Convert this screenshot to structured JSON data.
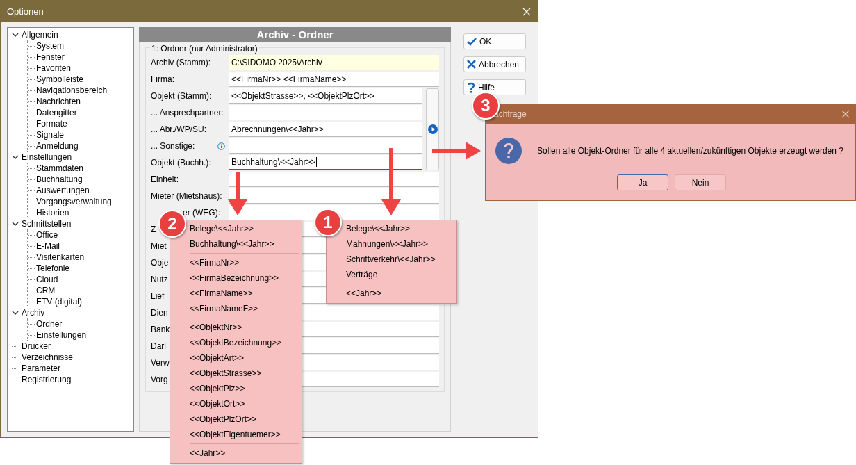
{
  "window": {
    "title": "Optionen"
  },
  "tree": [
    {
      "label": "Allgemein",
      "expanded": true,
      "children": [
        {
          "label": "System"
        },
        {
          "label": "Fenster"
        },
        {
          "label": "Favoriten"
        },
        {
          "label": "Symbolleiste"
        },
        {
          "label": "Navigationsbereich"
        },
        {
          "label": "Nachrichten"
        },
        {
          "label": "Datengitter"
        },
        {
          "label": "Formate"
        },
        {
          "label": "Signale"
        },
        {
          "label": "Anmeldung"
        }
      ]
    },
    {
      "label": "Einstellungen",
      "expanded": true,
      "children": [
        {
          "label": "Stammdaten"
        },
        {
          "label": "Buchhaltung"
        },
        {
          "label": "Auswertungen"
        },
        {
          "label": "Vorgangsverwaltung"
        },
        {
          "label": "Historien"
        }
      ]
    },
    {
      "label": "Schnittstellen",
      "expanded": true,
      "children": [
        {
          "label": "Office"
        },
        {
          "label": "E-Mail"
        },
        {
          "label": "Visitenkarten"
        },
        {
          "label": "Telefonie"
        },
        {
          "label": "Cloud"
        },
        {
          "label": "CRM"
        },
        {
          "label": "ETV (digital)"
        }
      ]
    },
    {
      "label": "Archiv",
      "expanded": true,
      "children": [
        {
          "label": "Ordner"
        },
        {
          "label": "Einstellungen"
        }
      ]
    },
    {
      "label": "Drucker",
      "expanded": false
    },
    {
      "label": "Verzeichnisse",
      "expanded": false
    },
    {
      "label": "Parameter",
      "expanded": false
    },
    {
      "label": "Registrierung",
      "expanded": false
    }
  ],
  "panel": {
    "title": "Archiv - Ordner",
    "group": "1: Ordner  (nur Administrator)",
    "rows": [
      {
        "label": "Archiv (Stamm):",
        "value": "C:\\SIDOMO 2025\\Archiv",
        "kind": "full",
        "highlighted": true,
        "focused": false,
        "info": false
      },
      {
        "label": "Firma:",
        "value": "<<FirmaNr>> <<FirmaName>>",
        "kind": "full",
        "highlighted": false,
        "focused": false,
        "info": false
      },
      {
        "label": "Objekt (Stamm):",
        "value": "<<ObjektStrasse>>, <<ObjektPlzOrt>>",
        "kind": "short",
        "highlighted": false,
        "focused": false,
        "info": false
      },
      {
        "label": "... Ansprechpartner:",
        "kind": "short",
        "highlighted": false,
        "focused": false,
        "info": false
      },
      {
        "label": "... Abr./WP/SU:",
        "value": "Abrechnungen\\<<Jahr>>",
        "kind": "short",
        "highlighted": false,
        "focused": false,
        "info": false
      },
      {
        "label": "... Sonstige:",
        "kind": "short",
        "highlighted": false,
        "focused": false,
        "info": true
      },
      {
        "label": "Objekt (Buchh.):",
        "value": "Buchhaltung\\<<Jahr>>",
        "kind": "short",
        "highlighted": false,
        "focused": true,
        "info": false
      },
      {
        "label": "Einheit:",
        "kind": "full",
        "highlighted": false,
        "focused": false,
        "info": false
      },
      {
        "label": "Mieter (Mietshaus):",
        "kind": "full",
        "highlighted": false,
        "focused": false,
        "info": false
      },
      {
        "label": "er (WEG):",
        "kind": "full",
        "highlighted": false,
        "focused": false,
        "info": false
      },
      {
        "label": "Z",
        "kind": "full",
        "highlighted": false,
        "focused": false,
        "info": false
      },
      {
        "label": "Miet",
        "kind": "full",
        "highlighted": false,
        "focused": false,
        "info": false
      },
      {
        "label": "Obje",
        "kind": "full",
        "highlighted": false,
        "focused": false,
        "info": false
      },
      {
        "label": "Nutz",
        "kind": "full",
        "highlighted": false,
        "focused": false,
        "info": false
      },
      {
        "label": "Lief",
        "kind": "full",
        "highlighted": false,
        "focused": false,
        "info": false
      },
      {
        "label": "Dien",
        "kind": "full",
        "highlighted": false,
        "focused": false,
        "info": false
      },
      {
        "label": "Bank",
        "kind": "full",
        "highlighted": false,
        "focused": false,
        "info": false
      },
      {
        "label": "Darl",
        "kind": "full",
        "highlighted": false,
        "focused": false,
        "info": false
      },
      {
        "label": "Verw",
        "kind": "full",
        "highlighted": false,
        "focused": false,
        "info": false
      },
      {
        "label": "Vorg",
        "kind": "full",
        "highlighted": false,
        "focused": false,
        "info": false
      }
    ]
  },
  "buttons": [
    {
      "label": "OK",
      "kind": "ok"
    },
    {
      "label": "Abbrechen",
      "kind": "cancel"
    },
    {
      "label": "Hilfe",
      "kind": "help"
    }
  ],
  "menus": [
    {
      "items": [
        {
          "kind": "item",
          "label": "Belege\\<<Jahr>>"
        },
        {
          "kind": "item",
          "label": "Buchhaltung\\<<Jahr>>"
        },
        {
          "kind": "separator"
        },
        {
          "kind": "item",
          "label": "<<FirmaNr>>"
        },
        {
          "kind": "item",
          "label": "<<FirmaBezeichnung>>"
        },
        {
          "kind": "item",
          "label": "<<FirmaName>>"
        },
        {
          "kind": "item",
          "label": "<<FirmaNameF>>"
        },
        {
          "kind": "separator"
        },
        {
          "kind": "item",
          "label": "<<ObjektNr>>"
        },
        {
          "kind": "item",
          "label": "<<ObjektBezeichnung>>"
        },
        {
          "kind": "item",
          "label": "<<ObjektArt>>"
        },
        {
          "kind": "item",
          "label": "<<ObjektStrasse>>"
        },
        {
          "kind": "item",
          "label": "<<ObjektPlz>>"
        },
        {
          "kind": "item",
          "label": "<<ObjektOrt>>"
        },
        {
          "kind": "item",
          "label": "<<ObjektPlzOrt>>"
        },
        {
          "kind": "item",
          "label": "<<ObjektEigentuemer>>"
        },
        {
          "kind": "separator"
        },
        {
          "kind": "item",
          "label": "<<Jahr>>"
        }
      ]
    },
    {
      "items": [
        {
          "kind": "item",
          "label": "Belege\\<<Jahr>>"
        },
        {
          "kind": "item",
          "label": "Mahnungen\\<<Jahr>>"
        },
        {
          "kind": "item",
          "label": "Schriftverkehr\\<<Jahr>>"
        },
        {
          "kind": "item",
          "label": "Verträge"
        },
        {
          "kind": "separator"
        },
        {
          "kind": "item",
          "label": "<<Jahr>>"
        }
      ]
    }
  ],
  "dialog": {
    "title": "achfrage",
    "message": "Sollen alle Objekt-Ordner für alle 4 aktuellen/zukünftigen Objekte erzeugt werden ?",
    "buttons": [
      {
        "label": "Ja",
        "default": true
      },
      {
        "label": "Nein",
        "default": false
      }
    ]
  },
  "annotations": [
    {
      "number": "2"
    },
    {
      "number": "1"
    },
    {
      "number": "3"
    }
  ]
}
